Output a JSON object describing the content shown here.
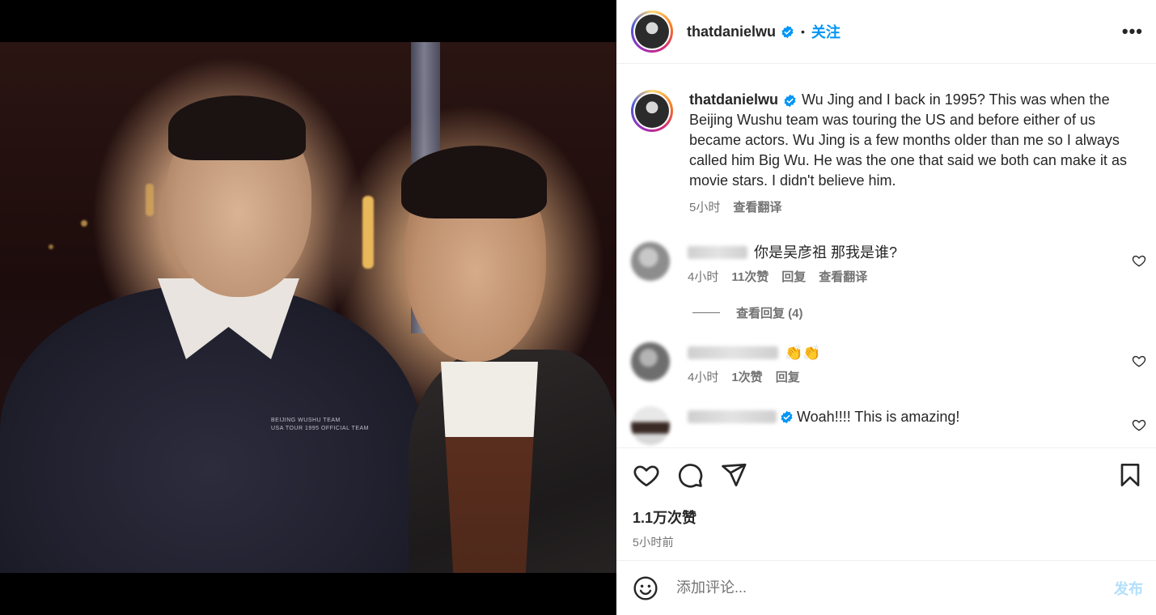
{
  "post": {
    "username": "thatdanielwu",
    "follow_label": "关注",
    "more_label": "•••",
    "caption": "Wu Jing and I back in 1995? This was when the Beijing Wushu team was touring the US and before either of us became actors. Wu Jing is a few months older than me so I always called him Big Wu. He was the one that said we both can make it as movie stars. I didn't believe him.",
    "caption_time": "5小时",
    "translate_label": "查看翻译",
    "likes": "1.1万次赞",
    "posted_ago": "5小时前",
    "photo_print_text": "BEIJING WUSHU TEAM\nUSA TOUR 1995 OFFICIAL TEAM"
  },
  "comments": [
    {
      "text": "你是吴彦祖 那我是谁?",
      "time": "4小时",
      "likes": "11次赞",
      "reply_label": "回复",
      "translate_label": "查看翻译",
      "view_replies": "查看回复 (4)",
      "avatar_color": "#9a9a9a"
    },
    {
      "text": "👏👏",
      "time": "4小时",
      "likes": "1次赞",
      "reply_label": "回复",
      "avatar_color": "#7d7d7d"
    },
    {
      "text": "Woah!!!! This is amazing!",
      "verified": true,
      "avatar_color": "#5a4a44"
    }
  ],
  "add_comment": {
    "placeholder": "添加评论...",
    "publish_label": "发布"
  },
  "icons": {
    "verified": "verified-badge-icon",
    "like": "heart-icon",
    "comment": "comment-bubble-icon",
    "share": "paper-plane-icon",
    "save": "bookmark-icon",
    "emoji": "emoji-smile-icon",
    "more": "more-horizontal-icon"
  },
  "colors": {
    "accent": "#0095f6",
    "secondary_text": "#737373",
    "publish_disabled": "#b2dffc"
  }
}
